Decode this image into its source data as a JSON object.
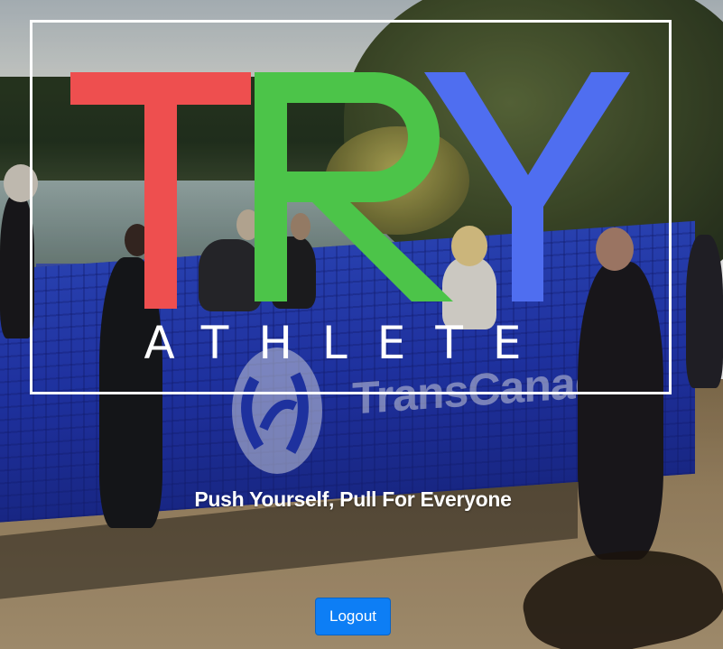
{
  "logo": {
    "title_letters": [
      {
        "char": "T",
        "color": "#ee4f4f"
      },
      {
        "char": "R",
        "color": "#4cc449"
      },
      {
        "char": "Y",
        "color": "#4f6ef0"
      }
    ],
    "subtitle": "ATHLETE",
    "frame_color": "#ffffff"
  },
  "tagline": "Push Yourself, Pull For Everyone",
  "actions": {
    "logout_label": "Logout",
    "logout_color": "#0d7ef5"
  },
  "background": {
    "banner_text": "TransCanada",
    "banner_color": "#2338b4"
  }
}
